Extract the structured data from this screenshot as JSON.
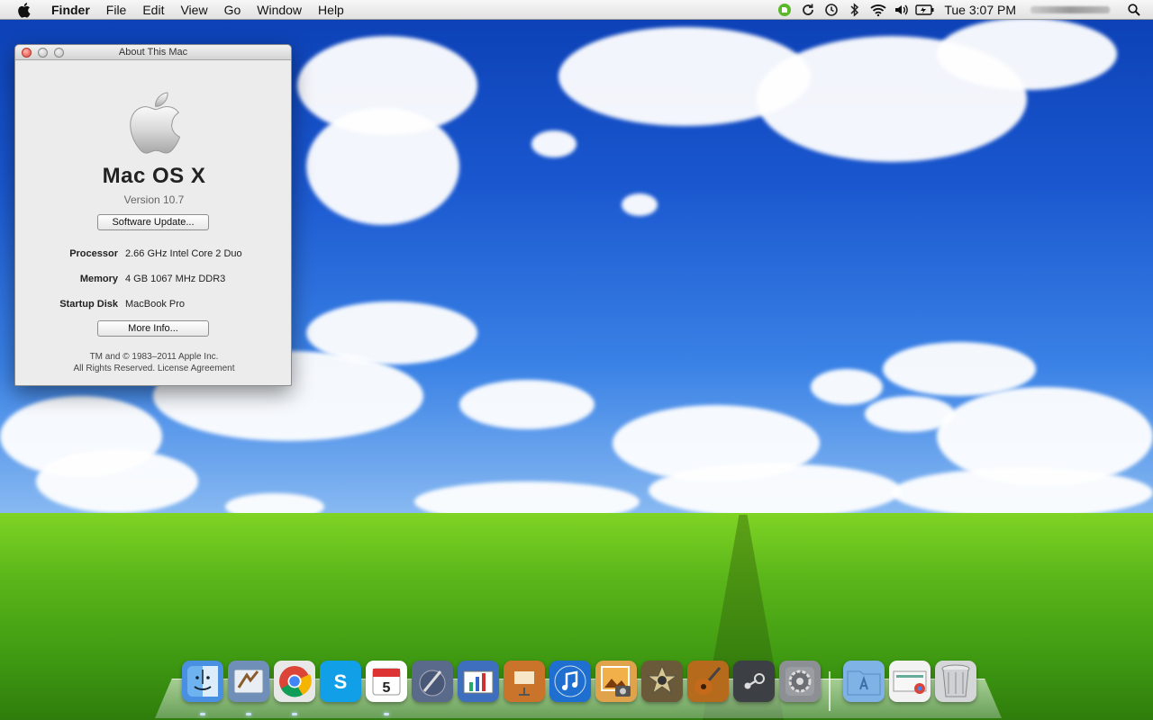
{
  "menubar": {
    "app_name": "Finder",
    "items": [
      "File",
      "Edit",
      "View",
      "Go",
      "Window",
      "Help"
    ],
    "status_icons": [
      "evernote-icon",
      "sync-icon",
      "time-machine-icon",
      "bluetooth-icon",
      "wifi-icon",
      "volume-icon",
      "battery-icon"
    ],
    "clock": "Tue 3:07 PM",
    "spotlight_icon": "spotlight-search-icon"
  },
  "about_window": {
    "title": "About This Mac",
    "os_name": "Mac OS X",
    "version": "Version 10.7",
    "software_update_label": "Software Update...",
    "specs": [
      {
        "label": "Processor",
        "value": "2.66 GHz Intel Core 2 Duo"
      },
      {
        "label": "Memory",
        "value": "4 GB 1067 MHz DDR3"
      },
      {
        "label": "Startup Disk",
        "value": "MacBook Pro"
      }
    ],
    "more_info_label": "More Info...",
    "copyright_line1": "TM and © 1983–2011 Apple Inc.",
    "copyright_line2": "All Rights Reserved.  License Agreement"
  },
  "dock": {
    "apps": [
      {
        "name": "finder-icon",
        "color": "#4a90e2"
      },
      {
        "name": "mail-icon",
        "color": "#6f8fb8"
      },
      {
        "name": "chrome-icon",
        "color": "#e8e8e8"
      },
      {
        "name": "skype-icon",
        "color": "#11a0e8"
      },
      {
        "name": "ical-icon",
        "color": "#ffffff"
      },
      {
        "name": "script-editor-icon",
        "color": "#5a6a8a"
      },
      {
        "name": "keynote-icon",
        "color": "#3e6fbf"
      },
      {
        "name": "presentation-icon",
        "color": "#c9742a"
      },
      {
        "name": "itunes-icon",
        "color": "#1f6fd1"
      },
      {
        "name": "iphoto-icon",
        "color": "#e0a24a"
      },
      {
        "name": "imovie-icon",
        "color": "#6b5a3a"
      },
      {
        "name": "garageband-icon",
        "color": "#b56a1c"
      },
      {
        "name": "steam-icon",
        "color": "#3c3f44"
      },
      {
        "name": "system-preferences-icon",
        "color": "#8c8f94"
      }
    ],
    "stacks": [
      {
        "name": "applications-folder-icon",
        "color": "#7fb3e6"
      },
      {
        "name": "downloads-stack-icon",
        "color": "#f2f2f2"
      },
      {
        "name": "trash-icon",
        "color": "#d4d6d8"
      }
    ]
  }
}
